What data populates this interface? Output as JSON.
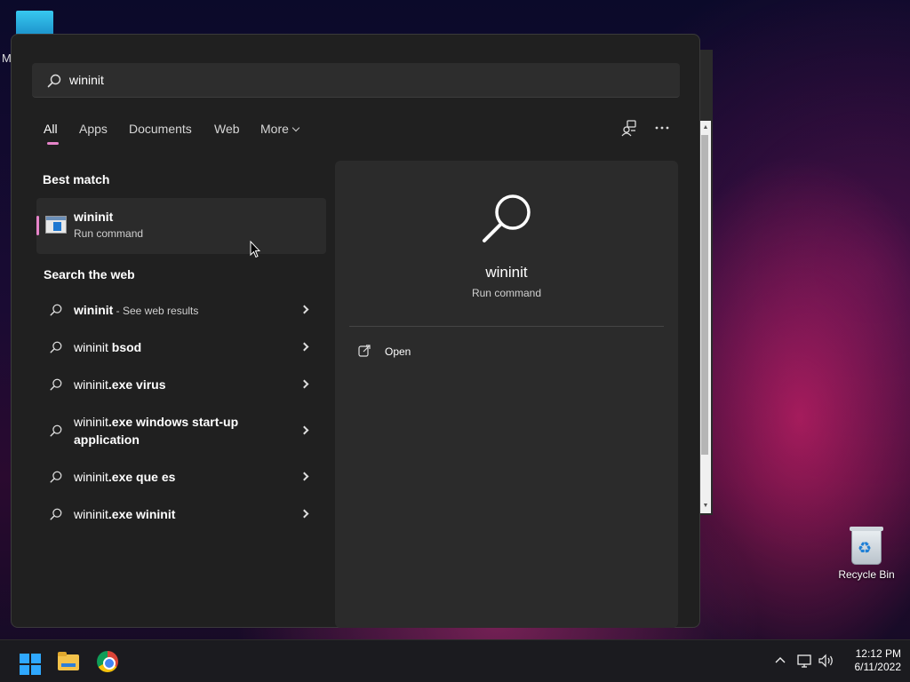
{
  "desktop": {
    "partial_label": "M",
    "recycle_bin_label": "Recycle Bin"
  },
  "search": {
    "query": "wininit",
    "icon": "search-icon"
  },
  "tabs": [
    {
      "label": "All",
      "active": true
    },
    {
      "label": "Apps"
    },
    {
      "label": "Documents"
    },
    {
      "label": "Web"
    },
    {
      "label": "More"
    }
  ],
  "toolbar": {
    "share_icon": "account-switch-icon",
    "more_icon": "ellipsis-icon"
  },
  "best_match": {
    "section_title": "Best match",
    "name": "wininit",
    "subtitle": "Run command",
    "icon": "run-command-icon",
    "accent_color": "#e684c9"
  },
  "web": {
    "section_title": "Search the web",
    "rows": [
      {
        "bold": "wininit",
        "rest": " - ",
        "small": "See web results"
      },
      {
        "light": "wininit ",
        "bold": "bsod"
      },
      {
        "light": "wininit",
        "bold": ".exe virus"
      },
      {
        "light": "wininit",
        "bold": ".exe windows start-up application"
      },
      {
        "light": "wininit",
        "bold": ".exe que es"
      },
      {
        "light": "wininit",
        "bold": ".exe wininit"
      }
    ]
  },
  "preview": {
    "title": "wininit",
    "subtitle": "Run command",
    "actions": [
      {
        "label": "Open",
        "icon": "open-external-icon"
      }
    ]
  },
  "taskbar": {
    "apps": [
      "start-button",
      "file-explorer",
      "chrome"
    ],
    "time": "12:12 PM",
    "date": "6/11/2022"
  }
}
